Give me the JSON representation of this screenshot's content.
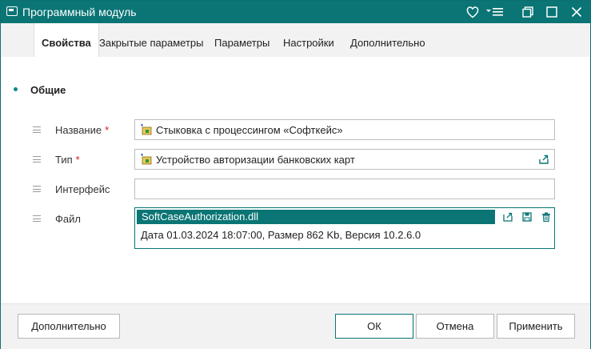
{
  "window": {
    "title": "Программный модуль"
  },
  "tabs": [
    {
      "label": "Свойства",
      "active": true
    },
    {
      "label": "Закрытые параметры"
    },
    {
      "label": "Параметры"
    },
    {
      "label": "Настройки"
    },
    {
      "label": "Дополнительно"
    }
  ],
  "section": {
    "title": "Общие"
  },
  "fields": {
    "name": {
      "label": "Название",
      "required": "*",
      "value": "Стыковка с процессингом «Софткейс»",
      "icon": "module-icon"
    },
    "type": {
      "label": "Тип",
      "required": "*",
      "value": "Устройство авторизации банковских карт",
      "icon": "module-icon"
    },
    "interface": {
      "label": "Интерфейс",
      "value": ""
    },
    "file": {
      "label": "Файл",
      "filename": "SoftCaseAuthorization.dll",
      "meta": "Дата 01.03.2024 18:07:00, Размер 862 Kb, Версия 10.2.6.0"
    }
  },
  "footer": {
    "more_label": "Дополнительно",
    "ok_label": "ОК",
    "cancel_label": "Отмена",
    "apply_label": "Применить"
  },
  "colors": {
    "accent": "#0b7575",
    "required": "#d01a1a"
  }
}
